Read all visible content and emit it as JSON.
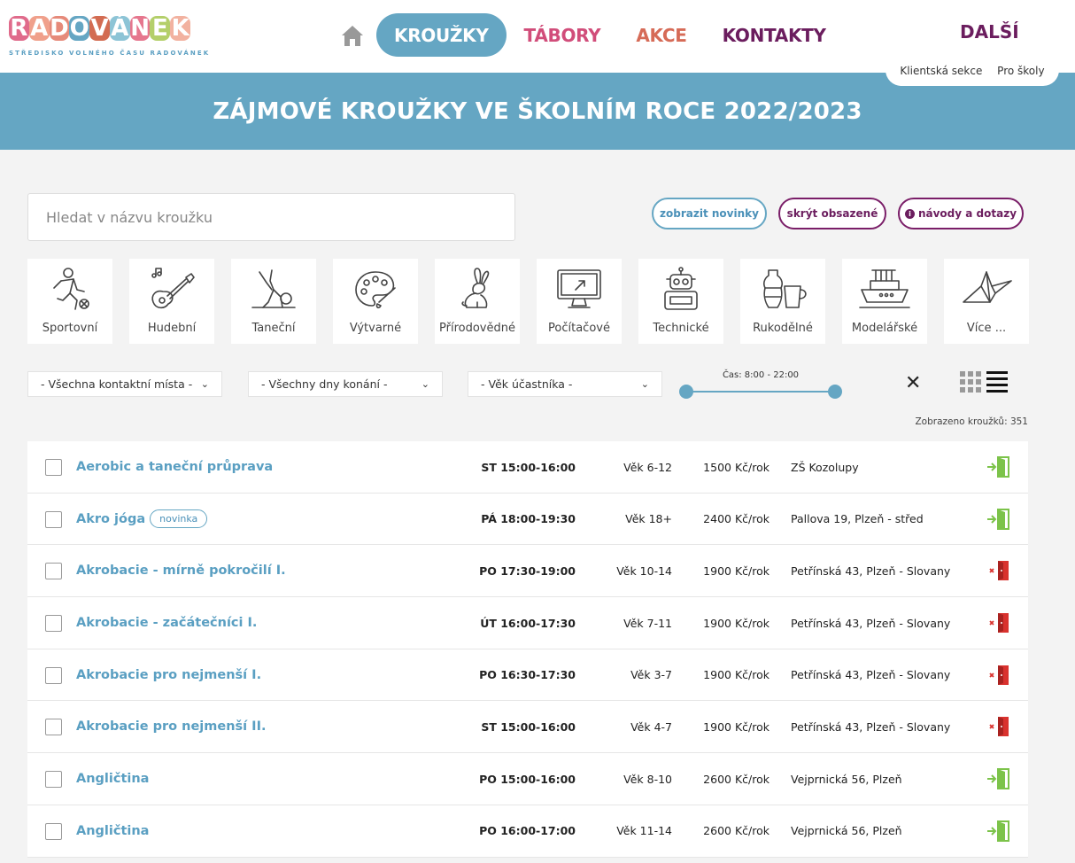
{
  "logo": {
    "letters": [
      "R",
      "A",
      "D",
      "O",
      "V",
      "Á",
      "N",
      "E",
      "K"
    ],
    "colors": [
      "#e06b8b",
      "#f0a08b",
      "#e68a7a",
      "#65a6c3",
      "#d36c52",
      "#8dc4d6",
      "#e6778e",
      "#b4cf6a",
      "#f2b2a0"
    ],
    "subtitle": "STŘEDISKO VOLNÉHO ČASU RADOVÁNEK"
  },
  "nav": {
    "items": [
      {
        "label": "KROUŽKY",
        "color": "#ffffff",
        "active": true
      },
      {
        "label": "TÁBORY",
        "color": "#d14d7a",
        "active": false
      },
      {
        "label": "AKCE",
        "color": "#d66b57",
        "active": false
      },
      {
        "label": "KONTAKTY",
        "color": "#6b1d5e",
        "active": false
      }
    ],
    "more": "DALŠÍ",
    "sub": [
      "Klientská sekce",
      "Pro školy"
    ]
  },
  "banner": {
    "title": "ZÁJMOVÉ KROUŽKY VE ŠKOLNÍM ROCE 2022/2023"
  },
  "search": {
    "placeholder": "Hledat v názvu kroužku"
  },
  "buttons": {
    "novinky": "zobrazit novinky",
    "skryt": "skrýt obsazené",
    "navody": "návody a dotazy"
  },
  "categories": [
    {
      "label": "Sportovní",
      "icon": "sport-icon"
    },
    {
      "label": "Hudební",
      "icon": "guitar-icon"
    },
    {
      "label": "Taneční",
      "icon": "dance-icon"
    },
    {
      "label": "Výtvarné",
      "icon": "palette-icon"
    },
    {
      "label": "Přírodovědné",
      "icon": "rabbit-icon"
    },
    {
      "label": "Počítačové",
      "icon": "computer-icon"
    },
    {
      "label": "Technické",
      "icon": "robot-icon"
    },
    {
      "label": "Rukodělné",
      "icon": "pottery-icon"
    },
    {
      "label": "Modelářské",
      "icon": "ship-icon"
    },
    {
      "label": "Více ...",
      "icon": "origami-icon"
    }
  ],
  "filters": {
    "place": "- Všechna kontaktní místa -",
    "days": "- Všechny dny konání -",
    "age": "- Věk účastníka -",
    "time": "Čas: 8:00 - 22:00"
  },
  "count": "Zobrazeno kroužků: 351",
  "rows": [
    {
      "name": "Aerobic a taneční průprava",
      "badge": "",
      "time": "ST 15:00-16:00",
      "age": "Věk 6-12",
      "price": "1500 Kč/rok",
      "place": "ZŠ Kozolupy",
      "status": "open"
    },
    {
      "name": "Akro jóga",
      "badge": "novinka",
      "time": "PÁ 18:00-19:30",
      "age": "Věk 18+",
      "price": "2400 Kč/rok",
      "place": "Pallova 19, Plzeň - střed",
      "status": "open"
    },
    {
      "name": "Akrobacie - mírně pokročilí I.",
      "badge": "",
      "time": "PO 17:30-19:00",
      "age": "Věk 10-14",
      "price": "1900 Kč/rok",
      "place": "Petřínská 43, Plzeň - Slovany",
      "status": "full"
    },
    {
      "name": "Akrobacie - začátečníci I.",
      "badge": "",
      "time": "ÚT 16:00-17:30",
      "age": "Věk 7-11",
      "price": "1900 Kč/rok",
      "place": "Petřínská 43, Plzeň - Slovany",
      "status": "full"
    },
    {
      "name": "Akrobacie pro nejmenší I.",
      "badge": "",
      "time": "PO 16:30-17:30",
      "age": "Věk 3-7",
      "price": "1900 Kč/rok",
      "place": "Petřínská 43, Plzeň - Slovany",
      "status": "full"
    },
    {
      "name": "Akrobacie pro nejmenší II.",
      "badge": "",
      "time": "ST 15:00-16:00",
      "age": "Věk 4-7",
      "price": "1900 Kč/rok",
      "place": "Petřínská 43, Plzeň - Slovany",
      "status": "full"
    },
    {
      "name": "Angličtina",
      "badge": "",
      "time": "PO 15:00-16:00",
      "age": "Věk 8-10",
      "price": "2600 Kč/rok",
      "place": "Vejprnická 56, Plzeň",
      "status": "open"
    },
    {
      "name": "Angličtina",
      "badge": "",
      "time": "PO 16:00-17:00",
      "age": "Věk 11-14",
      "price": "2600 Kč/rok",
      "place": "Vejprnická 56, Plzeň",
      "status": "open"
    }
  ],
  "status_colors": {
    "open": "#7cc34a",
    "full": "#d9322e"
  }
}
